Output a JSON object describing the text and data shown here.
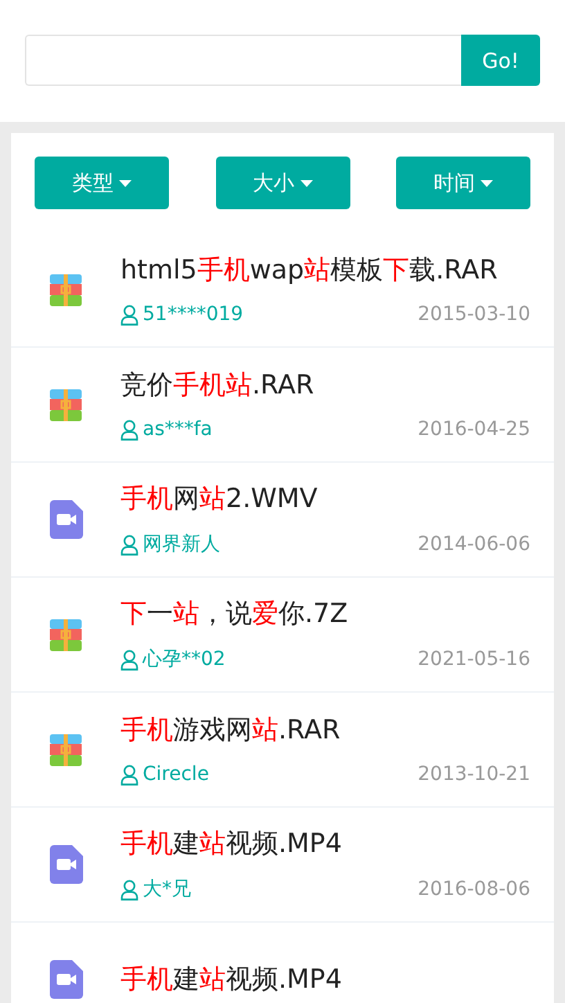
{
  "search": {
    "button": "Go!"
  },
  "filters": [
    {
      "label": "类型"
    },
    {
      "label": "大小"
    },
    {
      "label": "时间"
    }
  ],
  "files": [
    {
      "kind": "archive",
      "title": [
        {
          "text": "html5",
          "highlight": false
        },
        {
          "text": "手机",
          "highlight": true
        },
        {
          "text": "wap",
          "highlight": false
        },
        {
          "text": "站",
          "highlight": true
        },
        {
          "text": "模板",
          "highlight": false
        },
        {
          "text": "下",
          "highlight": true
        },
        {
          "text": "载.RAR",
          "highlight": false
        }
      ],
      "user": "51****019",
      "date": "2015-03-10"
    },
    {
      "kind": "archive",
      "title": [
        {
          "text": "竞价",
          "highlight": false
        },
        {
          "text": "手机站",
          "highlight": true
        },
        {
          "text": ".RAR",
          "highlight": false
        }
      ],
      "user": "as***fa",
      "date": "2016-04-25"
    },
    {
      "kind": "video",
      "title": [
        {
          "text": "手机",
          "highlight": true
        },
        {
          "text": "网",
          "highlight": false
        },
        {
          "text": "站",
          "highlight": true
        },
        {
          "text": "2.WMV",
          "highlight": false
        }
      ],
      "user": "网界新人",
      "date": "2014-06-06"
    },
    {
      "kind": "archive",
      "title": [
        {
          "text": "下",
          "highlight": true
        },
        {
          "text": "一",
          "highlight": false
        },
        {
          "text": "站",
          "highlight": true
        },
        {
          "text": "，说",
          "highlight": false
        },
        {
          "text": "爱",
          "highlight": true
        },
        {
          "text": "你.7Z",
          "highlight": false
        }
      ],
      "user": "心孕**02",
      "date": "2021-05-16"
    },
    {
      "kind": "archive",
      "title": [
        {
          "text": "手机",
          "highlight": true
        },
        {
          "text": "游戏网",
          "highlight": false
        },
        {
          "text": "站",
          "highlight": true
        },
        {
          "text": ".RAR",
          "highlight": false
        }
      ],
      "user": "Cirecle",
      "date": "2013-10-21"
    },
    {
      "kind": "video",
      "title": [
        {
          "text": "手机",
          "highlight": true
        },
        {
          "text": "建",
          "highlight": false
        },
        {
          "text": "站",
          "highlight": true
        },
        {
          "text": "视频.MP4",
          "highlight": false
        }
      ],
      "user": "大*兄",
      "date": "2016-08-06"
    },
    {
      "kind": "video",
      "title": [
        {
          "text": "手机",
          "highlight": true
        },
        {
          "text": "建",
          "highlight": false
        },
        {
          "text": "站",
          "highlight": true
        },
        {
          "text": "视频.MP4",
          "highlight": false
        }
      ]
    }
  ]
}
